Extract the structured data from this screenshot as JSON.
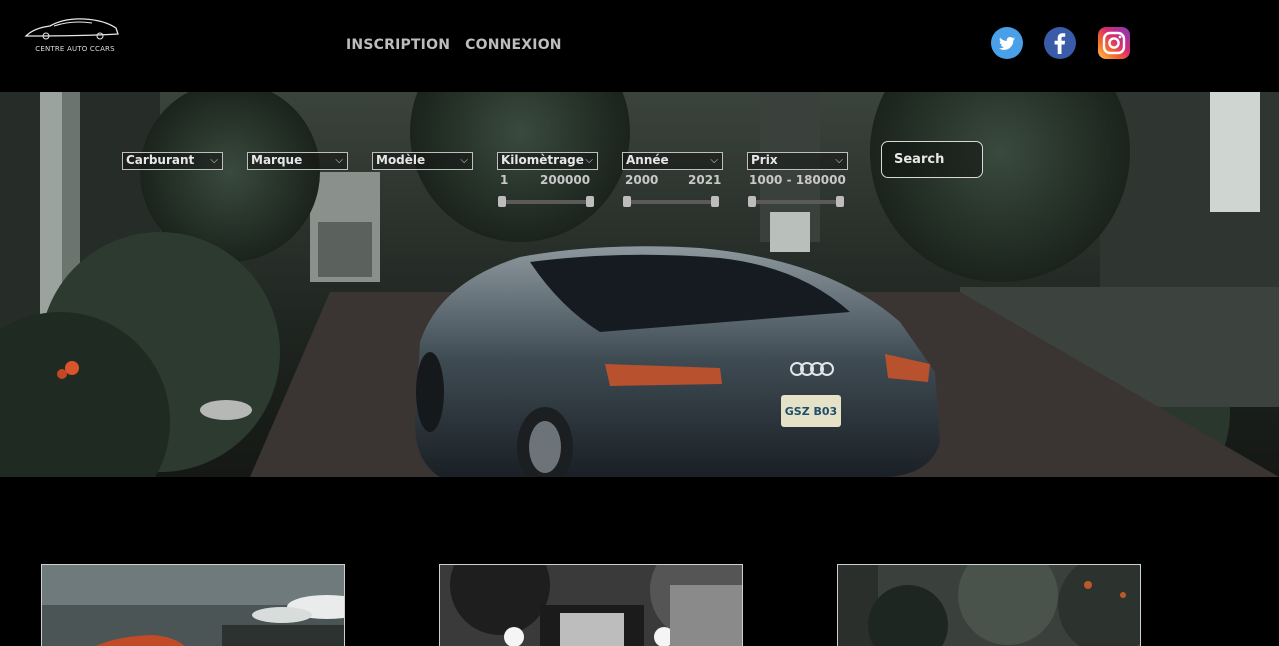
{
  "header": {
    "logo_text": "CENTRE AUTO CCARS",
    "nav": [
      {
        "label": "INSCRIPTION"
      },
      {
        "label": "CONNEXION"
      }
    ],
    "social": [
      "twitter-icon",
      "facebook-icon",
      "instagram-icon"
    ]
  },
  "filters": [
    {
      "label": "Carburant"
    },
    {
      "label": "Marque"
    },
    {
      "label": "Modèle"
    },
    {
      "label": "Kilomètrage",
      "range_min": "1",
      "range_max": "200000"
    },
    {
      "label": "Année",
      "range_min": "2000",
      "range_max": "2021"
    },
    {
      "label": "Prix",
      "range_text": "1000 - 180000"
    }
  ],
  "search": {
    "placeholder": "Search"
  },
  "hero": {
    "plate_text": "GSZ B03"
  }
}
